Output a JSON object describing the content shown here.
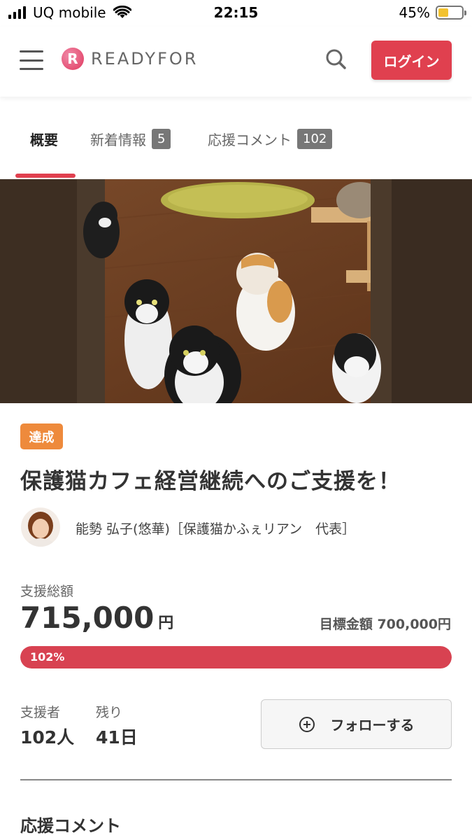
{
  "status_bar": {
    "carrier": "UQ mobile",
    "time": "22:15",
    "battery_percent": "45%",
    "battery_level": 0.45,
    "icons": [
      "signal-icon",
      "wifi-icon",
      "battery-icon"
    ]
  },
  "header": {
    "logo_text": "READYFOR",
    "logo_mark": "R",
    "login_label": "ログイン",
    "icons": [
      "hamburger-icon",
      "search-icon"
    ]
  },
  "tabs": [
    {
      "label": "概要",
      "badge": null,
      "active": true
    },
    {
      "label": "新着情報",
      "badge": "5",
      "active": false
    },
    {
      "label": "応援コメント",
      "badge": "102",
      "active": false
    }
  ],
  "project": {
    "status_badge": "達成",
    "title": "保護猫カフェ経営継続へのご支援を！",
    "owner": "能勢 弘子(悠華)［保護猫かふぇリアン　代表］"
  },
  "funding": {
    "total_label": "支援総額",
    "total_amount": "715,000",
    "total_unit": "円",
    "target_text": "目標金額 700,000円",
    "progress_text": "102%",
    "progress_fraction": 1.0,
    "supporters_label": "支援者",
    "supporters_value": "102人",
    "remaining_label": "残り",
    "remaining_value": "41日"
  },
  "follow_label": "フォローする",
  "comments_section_title": "応援コメント",
  "colors": {
    "accent": "#e0404f",
    "progress": "#d84251",
    "achieved_badge": "#ee8a3c",
    "tab_badge": "#777777"
  }
}
